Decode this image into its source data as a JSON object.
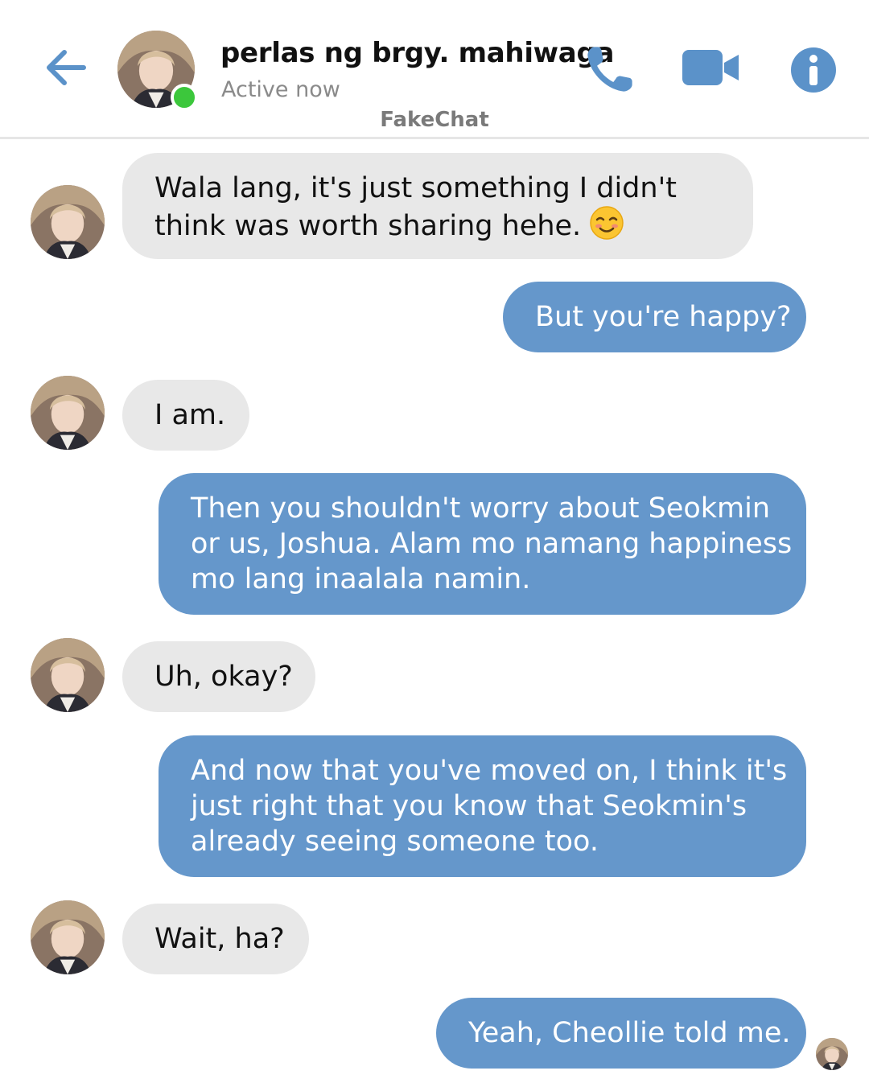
{
  "header": {
    "contact_name": "perlas ng brgy. mahiwaga",
    "status": "Active now",
    "watermark": "FakeChat",
    "icons": [
      "back-arrow-icon",
      "phone-icon",
      "video-camera-icon",
      "info-icon"
    ],
    "accent_color": "#5b92c9",
    "online_color": "#3cc73c"
  },
  "messages": [
    {
      "from": "contact",
      "lines": [
        "Wala lang, it's just something I didn't",
        "think was worth sharing hehe. "
      ],
      "emoji": "smiling-blush-emoji"
    },
    {
      "from": "me",
      "lines": [
        "But you're happy?"
      ]
    },
    {
      "from": "contact",
      "lines": [
        "I am."
      ]
    },
    {
      "from": "me",
      "lines": [
        "Then you shouldn't worry about Seokmin",
        "or us, Joshua. Alam mo namang happiness",
        "mo lang inaalala namin."
      ]
    },
    {
      "from": "contact",
      "lines": [
        "Uh, okay?"
      ]
    },
    {
      "from": "me",
      "lines": [
        "And now that you've moved on, I think it's",
        "just right that you know that Seokmin's",
        "already seeing someone too."
      ]
    },
    {
      "from": "contact",
      "lines": [
        "Wait, ha?"
      ]
    },
    {
      "from": "me",
      "lines": [
        "Yeah, Cheollie told me."
      ]
    }
  ],
  "colors": {
    "incoming_bubble": "#e8e8e8",
    "outgoing_bubble": "#6597cb"
  }
}
